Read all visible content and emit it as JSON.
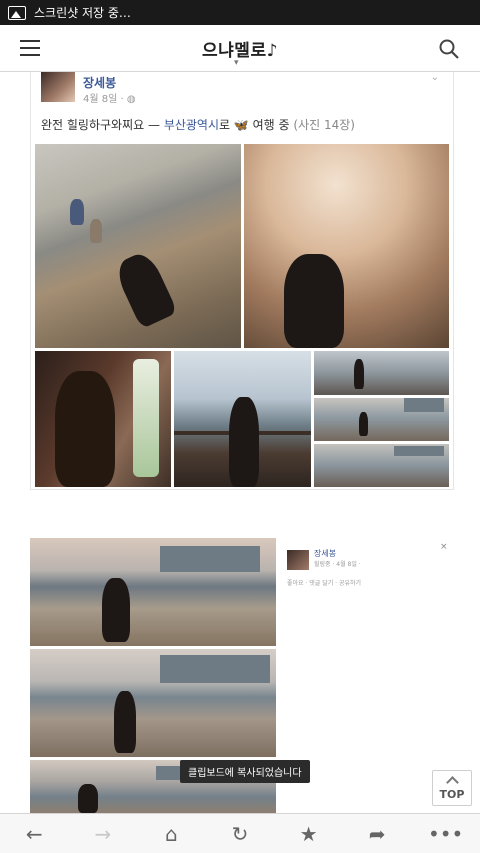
{
  "status_bar": {
    "text": "스크린샷 저장 중…",
    "icon": "image-icon"
  },
  "header": {
    "title": "으냐멜로♪",
    "menu_icon": "hamburger-icon",
    "search_icon": "search-icon"
  },
  "post": {
    "author": "장세봉",
    "date": "4월 8일 ·",
    "text_main": "완전 힐링하구와찌요 — ",
    "location": "부산광역시",
    "text_suffix": "로 🦋 여행 중 ",
    "photo_count": "(사진 14장)"
  },
  "clip": {
    "mini_name": "장세봉",
    "mini_date": "힐링중 · 4월 8일 ·",
    "mini_actions": "좋아요 · 댓글 달기 · 공유하기",
    "close": "×",
    "toast": "클립보드에 복사되었습니다"
  },
  "top_button": {
    "label": "TOP"
  },
  "bottom_bar": {
    "back": "←",
    "forward": "→",
    "home": "⌂",
    "refresh": "↻",
    "bookmark": "★",
    "share": "➦",
    "more": "•••"
  }
}
